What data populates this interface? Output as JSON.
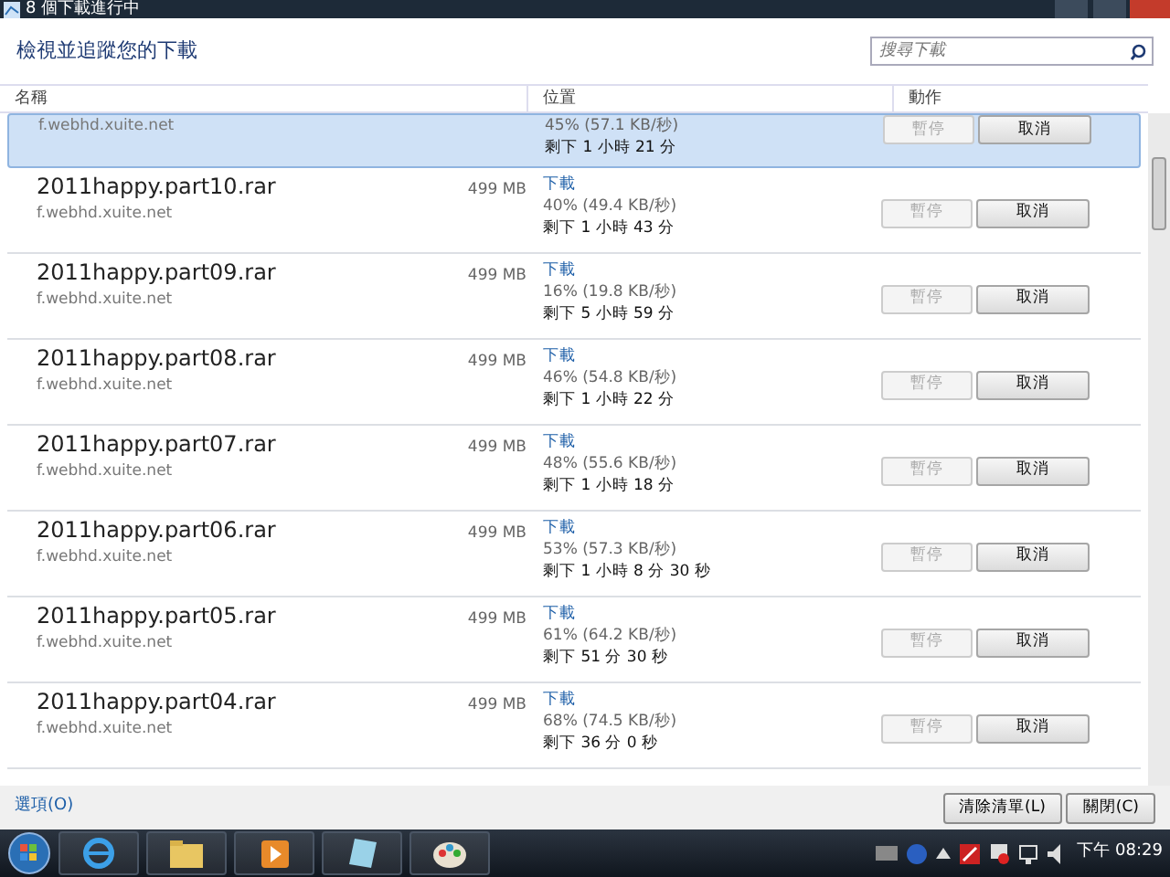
{
  "window": {
    "title": "8 個下載進行中"
  },
  "heading": "檢視並追蹤您的下載",
  "search": {
    "placeholder": "搜尋下載"
  },
  "columns": [
    "名稱",
    "位置",
    "動作"
  ],
  "downloads": [
    {
      "selected": true,
      "host": "f.webhd.xuite.net",
      "progress": "45% (57.1 KB/秒)",
      "remaining": "剩下 1 小時 21 分",
      "buttons": [
        {
          "label": "暫停",
          "disabled": true
        },
        {
          "label": "取消",
          "disabled": false
        }
      ]
    },
    {
      "selected": false,
      "name": "2011happy.part10.rar",
      "host": "f.webhd.xuite.net",
      "size": "499 MB",
      "status": "下載",
      "progress": "40% (49.4 KB/秒)",
      "remaining": "剩下 1 小時 43 分",
      "buttons": [
        {
          "label": "暫停",
          "disabled": true
        },
        {
          "label": "取消",
          "disabled": false
        }
      ]
    },
    {
      "selected": false,
      "name": "2011happy.part09.rar",
      "host": "f.webhd.xuite.net",
      "size": "499 MB",
      "status": "下載",
      "progress": "16% (19.8 KB/秒)",
      "remaining": "剩下 5 小時 59 分",
      "buttons": [
        {
          "label": "暫停",
          "disabled": true
        },
        {
          "label": "取消",
          "disabled": false
        }
      ]
    },
    {
      "selected": false,
      "name": "2011happy.part08.rar",
      "host": "f.webhd.xuite.net",
      "size": "499 MB",
      "status": "下載",
      "progress": "46% (54.8 KB/秒)",
      "remaining": "剩下 1 小時 22 分",
      "buttons": [
        {
          "label": "暫停",
          "disabled": true
        },
        {
          "label": "取消",
          "disabled": false
        }
      ]
    },
    {
      "selected": false,
      "name": "2011happy.part07.rar",
      "host": "f.webhd.xuite.net",
      "size": "499 MB",
      "status": "下載",
      "progress": "48% (55.6 KB/秒)",
      "remaining": "剩下 1 小時 18 分",
      "buttons": [
        {
          "label": "暫停",
          "disabled": true
        },
        {
          "label": "取消",
          "disabled": false
        }
      ]
    },
    {
      "selected": false,
      "name": "2011happy.part06.rar",
      "host": "f.webhd.xuite.net",
      "size": "499 MB",
      "status": "下載",
      "progress": "53% (57.3 KB/秒)",
      "remaining": "剩下 1 小時 8 分 30 秒",
      "buttons": [
        {
          "label": "暫停",
          "disabled": true
        },
        {
          "label": "取消",
          "disabled": false
        }
      ]
    },
    {
      "selected": false,
      "name": "2011happy.part05.rar",
      "host": "f.webhd.xuite.net",
      "size": "499 MB",
      "status": "下載",
      "progress": "61% (64.2 KB/秒)",
      "remaining": "剩下 51 分 30 秒",
      "buttons": [
        {
          "label": "暫停",
          "disabled": true
        },
        {
          "label": "取消",
          "disabled": false
        }
      ]
    },
    {
      "selected": false,
      "name": "2011happy.part04.rar",
      "host": "f.webhd.xuite.net",
      "size": "499 MB",
      "status": "下載",
      "progress": "68% (74.5 KB/秒)",
      "remaining": "剩下 36 分 0 秒",
      "buttons": [
        {
          "label": "暫停",
          "disabled": true
        },
        {
          "label": "取消",
          "disabled": false
        }
      ]
    }
  ],
  "footer": {
    "options_link": "選項(O)",
    "buttons": [
      "清除清單(L)",
      "關閉(C)"
    ]
  },
  "taskbar": {
    "clock": "下午 08:29"
  }
}
